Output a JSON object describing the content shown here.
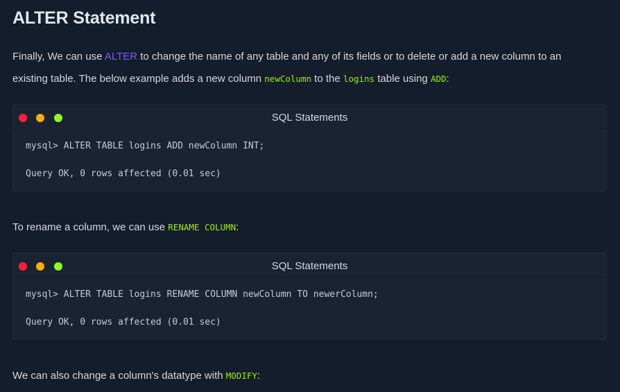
{
  "heading": "ALTER Statement",
  "intro": {
    "t1": "Finally, We can use ",
    "link": "ALTER",
    "t2": " to change the name of any table and any of its fields or to delete or add a new column to an",
    "t3": "existing table. The below example adds a new column ",
    "code1": "newColumn",
    "t4": " to the ",
    "code2": "logins",
    "t5": " table using ",
    "code3": "ADD",
    "t6": ":"
  },
  "box1": {
    "title": "SQL Statements",
    "line1": "mysql> ALTER TABLE logins ADD newColumn INT;",
    "line2": "Query OK, 0 rows affected (0.01 sec)"
  },
  "rename": {
    "t1": "To rename a column, we can use ",
    "code": "RENAME COLUMN",
    "t2": ":"
  },
  "box2": {
    "title": "SQL Statements",
    "line1": "mysql> ALTER TABLE logins RENAME COLUMN newColumn TO newerColumn;",
    "line2": "Query OK, 0 rows affected (0.01 sec)"
  },
  "modify": {
    "t1": "We can also change a column's datatype with ",
    "code": "MODIFY",
    "t2": ":"
  },
  "colors": {
    "background": "#141d2b",
    "codebox": "#1a2332",
    "code_green": "#9fef00",
    "link_purple": "#7b5cff",
    "dot_red": "#ff1e3c",
    "dot_yellow": "#ffaf00",
    "dot_green": "#8cff1e"
  }
}
